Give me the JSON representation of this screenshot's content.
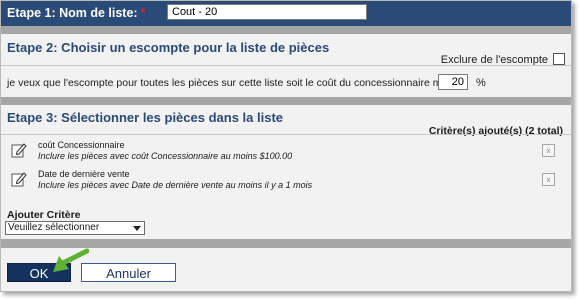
{
  "step1": {
    "title": "Etape 1: Nom de liste:",
    "required_mark": "*",
    "name_value": "Cout - 20"
  },
  "step2": {
    "title": "Etape 2: Choisir un escompte pour la liste de pièces",
    "exclude_label": "Exclure de l'escompte",
    "discount_text": "je veux que l'escompte pour toutes les pièces sur cette liste soit le coût du concessionnaire moins:",
    "discount_value": "20",
    "percent_sign": "%"
  },
  "step3": {
    "title": "Etape 3: Sélectionner les pièces dans la liste",
    "criteria_added": "Critère(s) ajouté(s) (2 total)",
    "criteria": [
      {
        "name": "coût Concessionnaire",
        "desc": "Inclure les pièces avec coût Concessionnaire au moins $100.00",
        "remove": "x"
      },
      {
        "name": "Date de dernière vente",
        "desc": "Inclure les pièces avec Date de dernière vente au moins il y a 1 mois",
        "remove": "x"
      }
    ],
    "add_criteria_label": "Ajouter Critère",
    "add_criteria_selected": "Veuillez sélectionner"
  },
  "buttons": {
    "ok": "OK",
    "cancel": "Annuler"
  },
  "colors": {
    "header_bg": "#2a4a78",
    "section_title": "#2a4a78",
    "separator": "#a6a6a6",
    "ok_bg": "#15325e",
    "arrow": "#5db233"
  }
}
